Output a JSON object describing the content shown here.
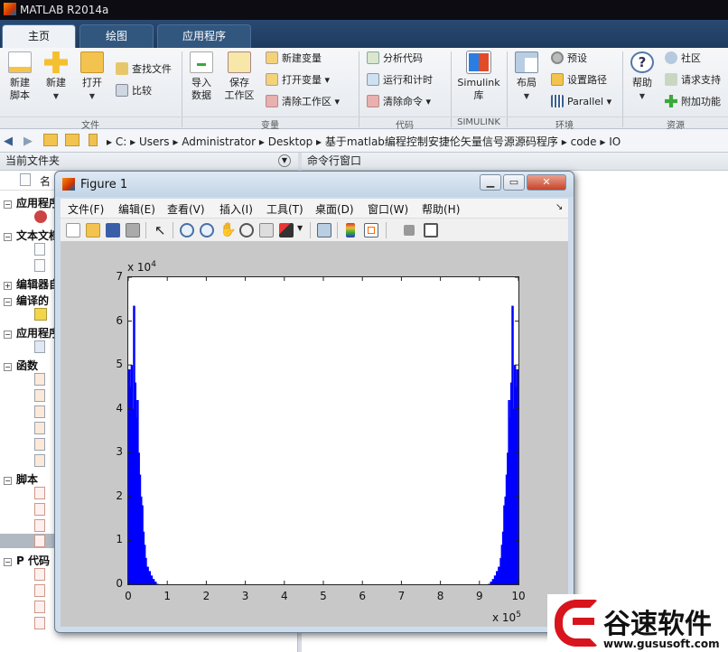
{
  "window": {
    "title": "MATLAB R2014a"
  },
  "tabs": [
    {
      "label": "主页",
      "active": true
    },
    {
      "label": "绘图",
      "active": false
    },
    {
      "label": "应用程序",
      "active": false
    }
  ],
  "ribbon": {
    "file_group": "文件",
    "variable_group": "变量",
    "code_group": "代码",
    "simulink_group": "SIMULINK",
    "env_group": "环境",
    "resource_group": "资源",
    "new_script": "新建\n脚本",
    "new": "新建",
    "open": "打开",
    "find_files": "查找文件",
    "compare": "比较",
    "import_data": "导入\n数据",
    "save_workspace": "保存\n工作区",
    "new_variable": "新建变量",
    "open_variable": "打开变量",
    "clear_workspace": "清除工作区",
    "analyze_code": "分析代码",
    "run_and_time": "运行和计时",
    "clear_commands": "清除命令",
    "simulink": "Simulink\n库",
    "layout": "布局",
    "preferences": "预设",
    "set_path": "设置路径",
    "parallel": "Parallel",
    "help": "帮助",
    "community": "社区",
    "request_support": "请求支持",
    "addons": "附加功能"
  },
  "address": {
    "crumbs": [
      "C:",
      "Users",
      "Administrator",
      "Desktop",
      "基于matlab编程控制安捷伦矢量信号源源码程序",
      "code",
      "IO"
    ]
  },
  "left_panel": {
    "header": "当前文件夹",
    "column": "名",
    "categories": [
      {
        "label": "应用程序",
        "sign": "−"
      },
      {
        "label": "文本文档",
        "sign": "−"
      },
      {
        "label": "编辑器自",
        "sign": "+"
      },
      {
        "label": "编译的",
        "sign": "−"
      },
      {
        "label": "应用程序",
        "sign": "−"
      },
      {
        "label": "函数",
        "sign": "−"
      },
      {
        "label": "脚本",
        "sign": "−"
      },
      {
        "label": "P 代码",
        "sign": "−"
      }
    ]
  },
  "right_panel": {
    "header": "命令行窗口"
  },
  "figure": {
    "title": "Figure 1",
    "menus": [
      "文件(F)",
      "编辑(E)",
      "查看(V)",
      "插入(I)",
      "工具(T)",
      "桌面(D)",
      "窗口(W)",
      "帮助(H)"
    ],
    "y_multiplier": "x 10",
    "y_exp": "4",
    "x_multiplier": "x 10",
    "x_exp": "5"
  },
  "chart_data": {
    "type": "bar",
    "title": "",
    "xlabel": "",
    "ylabel": "",
    "xlim": [
      0,
      1000000
    ],
    "ylim": [
      0,
      70000
    ],
    "x_ticks": [
      "0",
      "1",
      "2",
      "3",
      "4",
      "5",
      "6",
      "7",
      "8",
      "9",
      "10"
    ],
    "y_ticks": [
      "0",
      "1",
      "2",
      "3",
      "4",
      "5",
      "6",
      "7"
    ],
    "color": "#0000ff",
    "series": [
      {
        "x": [
          3000,
          6000,
          9000,
          12000,
          15000,
          18000,
          21000,
          24000,
          27000,
          30000,
          33000,
          36000,
          39000,
          42000,
          45000,
          50000,
          55000,
          60000,
          65000,
          70000,
          75000
        ],
        "y": [
          49000,
          45000,
          50000,
          40000,
          63500,
          46000,
          38000,
          42000,
          30000,
          25000,
          20000,
          18000,
          12000,
          9000,
          6000,
          4000,
          3000,
          2000,
          1200,
          600,
          100
        ]
      },
      {
        "x": [
          925000,
          930000,
          935000,
          940000,
          945000,
          950000,
          955000,
          958000,
          961000,
          964000,
          967000,
          970000,
          973000,
          976000,
          979000,
          982000,
          985000,
          988000,
          991000,
          994000,
          997000
        ],
        "y": [
          100,
          600,
          1200,
          2000,
          3000,
          4000,
          6000,
          9000,
          12000,
          18000,
          20000,
          25000,
          30000,
          42000,
          38000,
          46000,
          63500,
          40000,
          50000,
          45000,
          49000
        ]
      }
    ]
  },
  "logo": {
    "text": "谷速软件",
    "url": "www.gususoft.com"
  }
}
